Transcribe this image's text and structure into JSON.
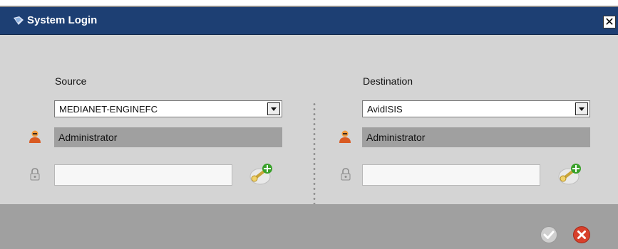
{
  "window": {
    "title": "System Login",
    "close_symbol": "✕"
  },
  "source": {
    "label": "Source",
    "server": "MEDIANET-ENGINEFC",
    "user": "Administrator",
    "password": ""
  },
  "destination": {
    "label": "Destination",
    "server": "AvidISIS",
    "user": "Administrator",
    "password": ""
  },
  "icons": {
    "title": "app-window-icon",
    "user": "user-icon",
    "lock": "lock-icon",
    "add_credentials": "add-key-icon",
    "ok": "checkmark-icon",
    "cancel": "cancel-icon"
  },
  "colors": {
    "titlebar": "#1d3f73",
    "content_bg": "#d4d4d4",
    "footer_bg": "#a0a0a0",
    "cancel_red": "#d8402b",
    "add_green": "#3aa12b"
  }
}
